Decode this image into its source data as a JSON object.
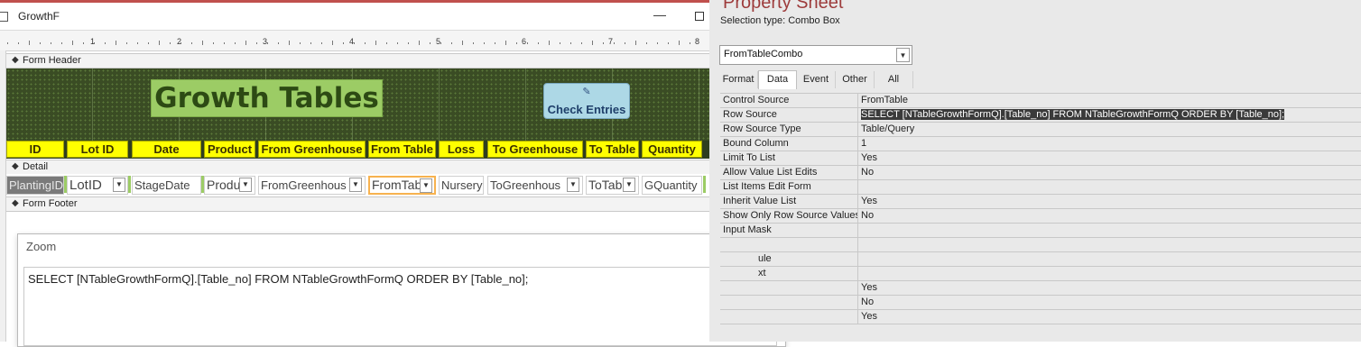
{
  "window": {
    "title": "GrowthF"
  },
  "ruler": {
    "numbers": [
      "1",
      "2",
      "3",
      "4",
      "5",
      "6",
      "7",
      "8"
    ]
  },
  "sections": {
    "header": "Form Header",
    "detail": "Detail",
    "footer": "Form Footer"
  },
  "header": {
    "title": "Growth Tables",
    "check_button": "Check Entries"
  },
  "column_labels": [
    "ID",
    "Lot ID",
    "Date",
    "Product",
    "From Greenhouse",
    "From Table",
    "Loss",
    "To Greenhouse",
    "To Table",
    "Quantity"
  ],
  "detail_controls": [
    "PlantingID",
    "LotID",
    "StageDate",
    "Produ",
    "FromGreenhous",
    "FromTab",
    "Nursery",
    "ToGreenhous",
    "ToTab",
    "GQuantity"
  ],
  "zoom": {
    "title": "Zoom",
    "help": "?",
    "text": "SELECT [NTableGrowthFormQ].[Table_no] FROM NTableGrowthFormQ ORDER BY [Table_no];"
  },
  "property_sheet": {
    "title": "Property Sheet",
    "selection_type": "Selection type:  Combo Box",
    "selected_object": "FromTableCombo",
    "tabs": [
      "Format",
      "Data",
      "Event",
      "Other",
      "All"
    ],
    "active_tab": "Data",
    "rows": [
      {
        "name": "Control Source",
        "value": "FromTable"
      },
      {
        "name": "Row Source",
        "value": "SELECT [NTableGrowthFormQ].[Table_no] FROM NTableGrowthFormQ ORDER BY [Table_no];"
      },
      {
        "name": "Row Source Type",
        "value": "Table/Query"
      },
      {
        "name": "Bound Column",
        "value": "1"
      },
      {
        "name": "Limit To List",
        "value": "Yes"
      },
      {
        "name": "Allow Value List Edits",
        "value": "No"
      },
      {
        "name": "List Items Edit Form",
        "value": ""
      },
      {
        "name": "Inherit Value List",
        "value": "Yes"
      },
      {
        "name": "Show Only Row Source Values",
        "value": "No"
      },
      {
        "name": "Input Mask",
        "value": ""
      },
      {
        "name": "",
        "value": ""
      },
      {
        "name": "ule",
        "value": ""
      },
      {
        "name": "xt",
        "value": ""
      },
      {
        "name": "",
        "value": "Yes"
      },
      {
        "name": "",
        "value": "No"
      },
      {
        "name": "",
        "value": "Yes"
      }
    ]
  }
}
